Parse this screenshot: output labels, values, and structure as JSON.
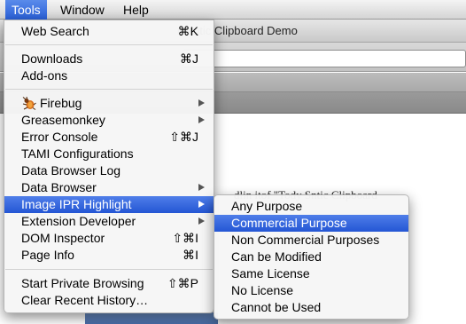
{
  "menubar": {
    "items": [
      "Tools",
      "Window",
      "Help"
    ]
  },
  "window": {
    "title_fragment": "mantic Clipboard Demo"
  },
  "page": {
    "body_text_fragment": "dlin    itof    \"Tody    Sntic Clipboard"
  },
  "tools_menu": {
    "items": [
      {
        "label": "Web Search",
        "shortcut": "⌘K"
      },
      {
        "label": "Downloads",
        "shortcut": "⌘J"
      },
      {
        "label": "Add-ons",
        "shortcut": ""
      },
      {
        "label": "Firebug",
        "shortcut": ""
      },
      {
        "label": "Greasemonkey",
        "shortcut": ""
      },
      {
        "label": "Error Console",
        "shortcut": "⇧⌘J"
      },
      {
        "label": "TAMI Configurations",
        "shortcut": ""
      },
      {
        "label": "Data Browser Log",
        "shortcut": ""
      },
      {
        "label": "Data Browser",
        "shortcut": ""
      },
      {
        "label": "Image IPR Highlight",
        "shortcut": ""
      },
      {
        "label": "Extension Developer",
        "shortcut": ""
      },
      {
        "label": "DOM Inspector",
        "shortcut": "⇧⌘I"
      },
      {
        "label": "Page Info",
        "shortcut": "⌘I"
      },
      {
        "label": "Start Private Browsing",
        "shortcut": "⇧⌘P"
      },
      {
        "label": "Clear Recent History…",
        "shortcut": ""
      }
    ],
    "highlighted": "Image IPR Highlight"
  },
  "ipr_submenu": {
    "items": [
      {
        "label": "Any Purpose"
      },
      {
        "label": "Commercial Purpose"
      },
      {
        "label": "Non Commercial Purposes"
      },
      {
        "label": "Can be Modified"
      },
      {
        "label": "Same License"
      },
      {
        "label": "No License"
      },
      {
        "label": "Cannot be Used"
      }
    ],
    "highlighted": "Commercial Purpose"
  },
  "colors": {
    "highlight": "#2f63dc",
    "menu_bg": "#f6f6f6"
  },
  "icons": {
    "firebug": "firebug-icon",
    "submenu_arrow": "submenu-arrow-icon"
  }
}
